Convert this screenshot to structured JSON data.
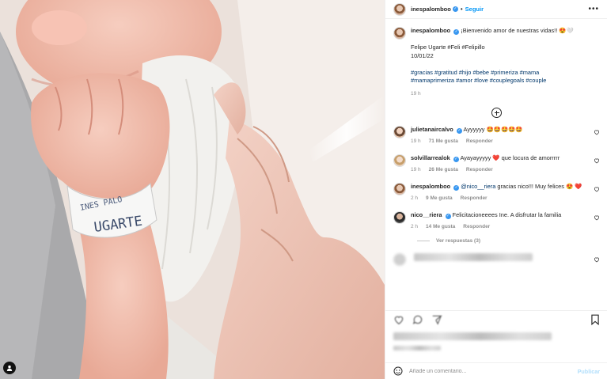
{
  "post": {
    "author": "inespalomboo",
    "follow_label": "Seguir",
    "more_label": "•••",
    "caption": {
      "lines": [
        "¡Bienvenido amor de nuestras vidas!! 😍🤍",
        "",
        "Felipe Ugarte #Feli #Felipillo",
        "10/01/22",
        "",
        "#gracias #gratitud #hijo #bebe #primeriza #mama",
        "#mamaprimeriza #amor #love #couplegoals #couple"
      ],
      "time": "19 h"
    },
    "wristband_text": "UGARTE",
    "wristband_text2": "INES PALO"
  },
  "comments": [
    {
      "user": "julietanaircalvo",
      "text": "Ayyyyyy 🤩🤩🤩🤩🤩",
      "time": "19 h",
      "likes": "71 Me gusta",
      "reply": "Responder"
    },
    {
      "user": "solvillarrealok",
      "text": "Ayayayyyyy ❤️ que locura de amorrrrr",
      "time": "19 h",
      "likes": "26 Me gusta",
      "reply": "Responder"
    },
    {
      "user": "inespalomboo",
      "mention": "@nico__riera",
      "text": " gracias nico!!! Muy felices 😍 ❤️",
      "time": "2 h",
      "likes": "9 Me gusta",
      "reply": "Responder"
    },
    {
      "user": "nico__riera",
      "text": "Felicitacioneeees Ine. A disfrutar la familia",
      "time": "2 h",
      "likes": "14 Me gusta",
      "reply": "Responder"
    }
  ],
  "view_replies": "Ver respuestas (3)",
  "add_comment": {
    "placeholder": "Añade un comentario...",
    "publish": "Publicar"
  },
  "icons": {
    "more": "more-dots-icon",
    "add": "plus-circle-icon",
    "heart": "heart-outline-icon",
    "save": "bookmark-icon",
    "emoji": "emoji-icon",
    "user_tag": "user-tag-icon"
  },
  "colors": {
    "link": "#0095f6",
    "verified": "#3897f0",
    "hashtag": "#00376b",
    "muted": "#8e8e8e"
  }
}
